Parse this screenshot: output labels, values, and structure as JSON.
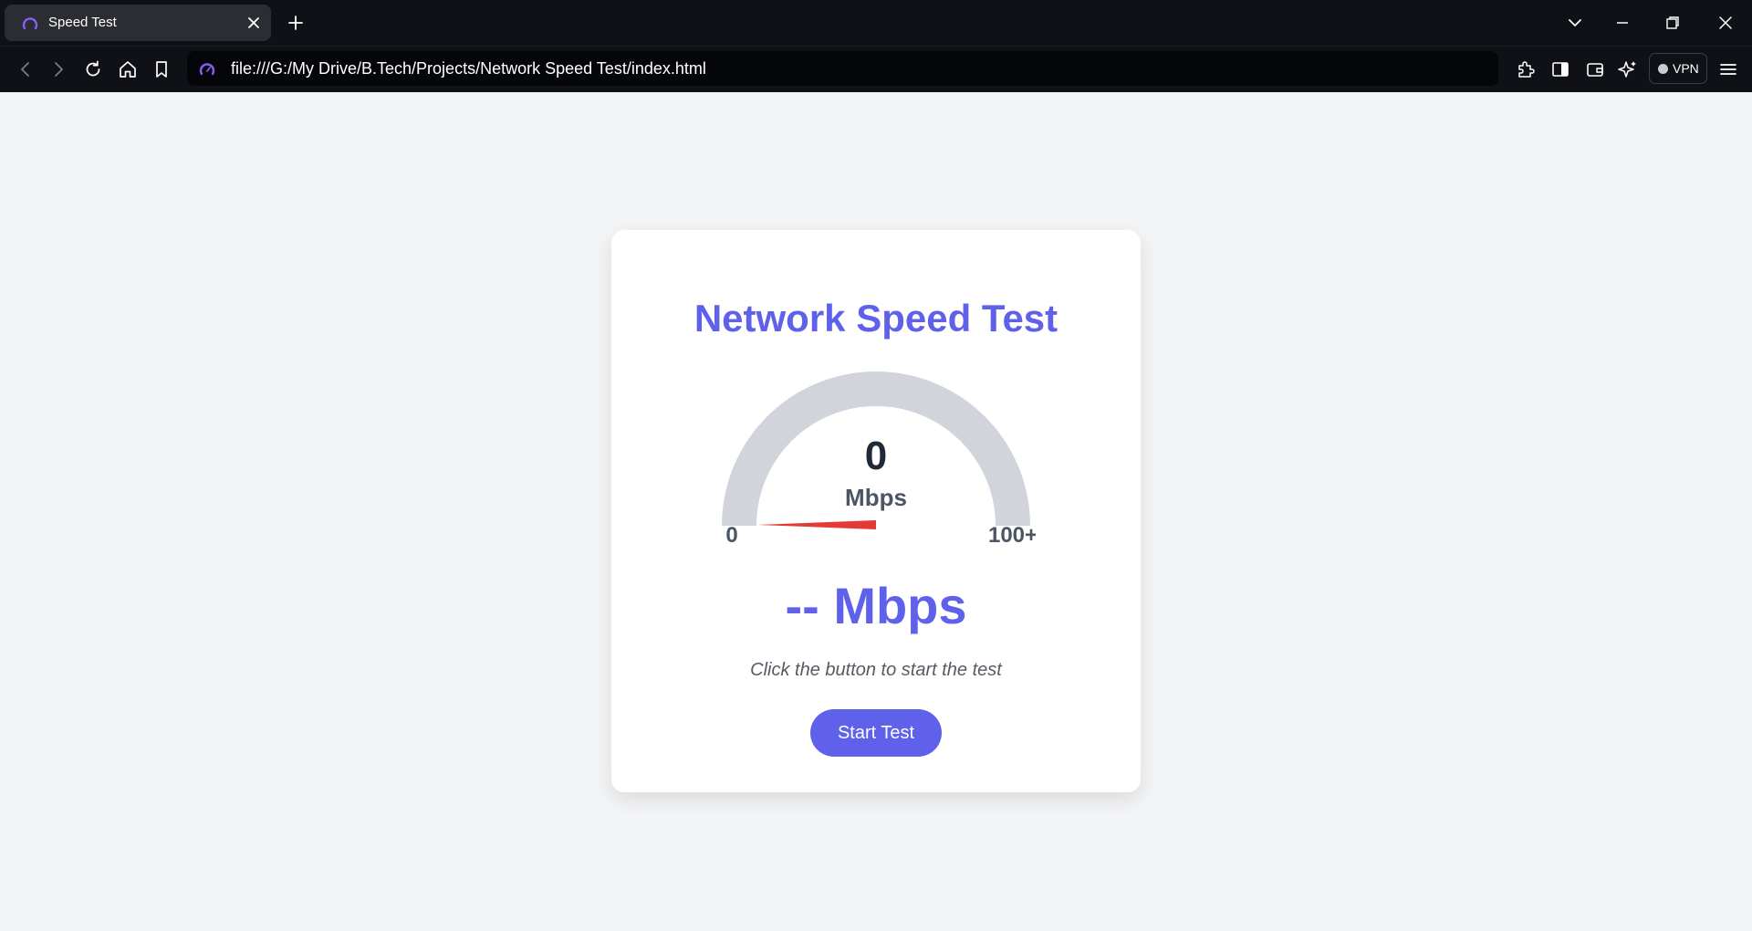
{
  "browser": {
    "tab": {
      "title": "Speed Test"
    },
    "address_bar": {
      "url": "file:///G:/My Drive/B.Tech/Projects/Network Speed Test/index.html"
    },
    "vpn_label": "VPN",
    "colors": {
      "chrome_bg": "#0f1117",
      "tab_active_bg": "#2b2d33",
      "favicon_accent": "#8b5cf6"
    }
  },
  "page": {
    "title": "Network Speed Test",
    "gauge": {
      "value": "0",
      "unit": "Mbps",
      "min_label": "0",
      "max_label": "100+",
      "needle_value": 0,
      "track_color": "#d1d5db",
      "needle_color": "#e53935"
    },
    "speed_display": "-- Mbps",
    "status": "Click the button to start the test",
    "start_button": "Start Test",
    "colors": {
      "accent": "#6061ea",
      "background": "#f3f4f6",
      "card": "#ffffff"
    }
  }
}
